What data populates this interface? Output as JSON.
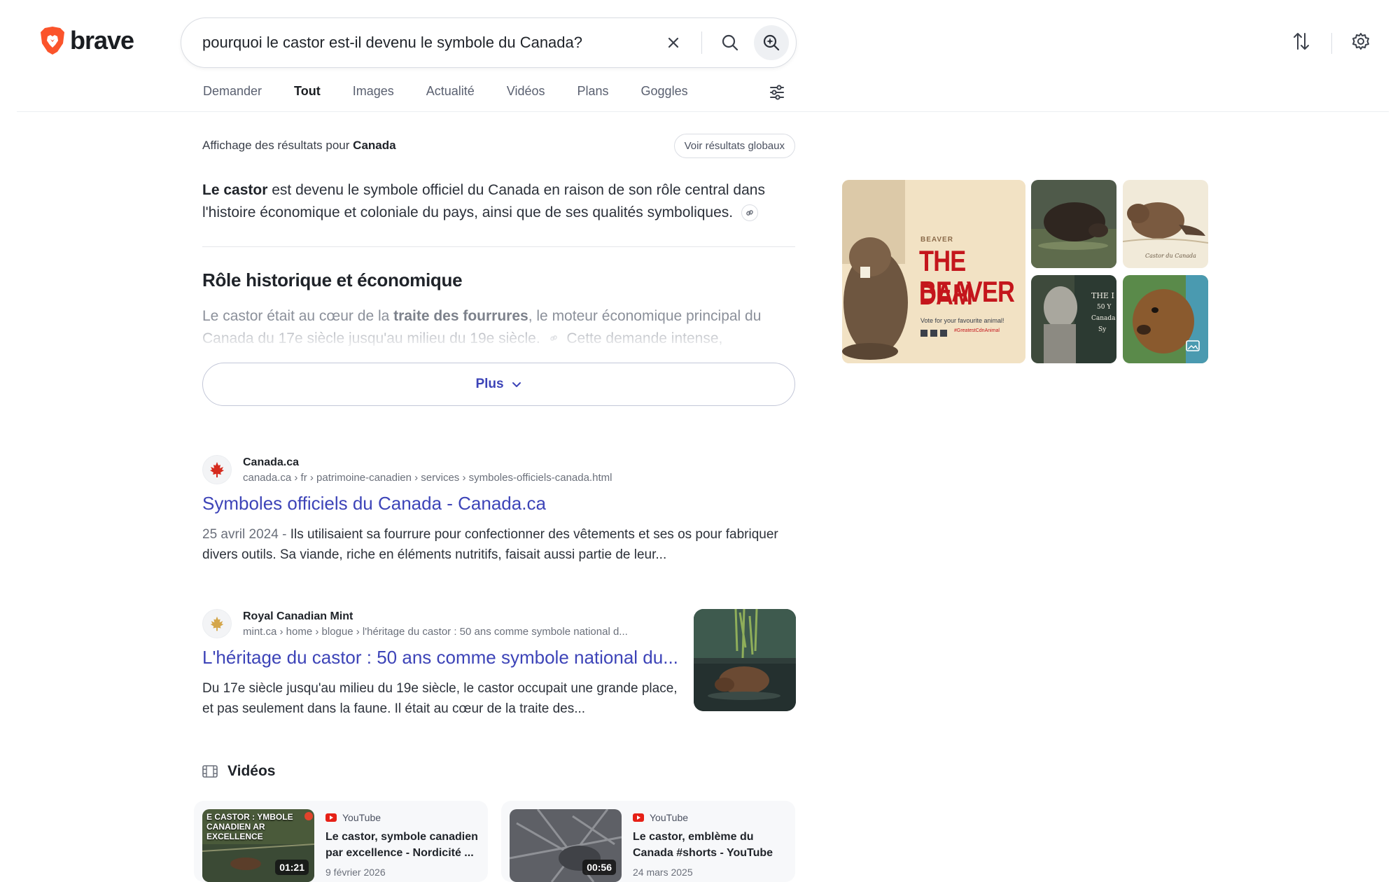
{
  "header": {
    "logo_text": "brave",
    "search_value": "pourquoi le castor est-il devenu le symbole du Canada?",
    "brand_color": "#fb542b",
    "accent_color": "#3d44b8"
  },
  "tabs": [
    {
      "label": "Demander"
    },
    {
      "label": "Tout"
    },
    {
      "label": "Images"
    },
    {
      "label": "Actualité"
    },
    {
      "label": "Vidéos"
    },
    {
      "label": "Plans"
    },
    {
      "label": "Goggles"
    }
  ],
  "active_tab": "Tout",
  "showing": {
    "prefix": "Affichage des résultats pour",
    "region": "Canada",
    "global_button": "Voir résultats globaux"
  },
  "answer": {
    "bold": "Le castor",
    "text": "est devenu le symbole officiel du Canada en raison de son rôle central dans l'histoire économique et coloniale du pays, ainsi que de ses qualités symboliques.",
    "section_title": "Rôle historique et économique",
    "fade_prefix": "Le castor était au cœur de la",
    "fade_bold": "traite des fourrures",
    "fade_suffix": ", le moteur économique principal du Canada du 17e siècle jusqu'au milieu du 19e siècle.",
    "fade_tail": "Cette demande intense,",
    "more_button": "Plus"
  },
  "results": [
    {
      "site": "Canada.ca",
      "url": "canada.ca › fr › patrimoine-canadien › services › symboles-officiels-canada.html",
      "title": "Symboles officiels du Canada - Canada.ca",
      "date": "25 avril 2024 -",
      "snippet": "Ils utilisaient sa fourrure pour confectionner des vêtements et ses os pour fabriquer divers outils. Sa viande, riche en éléments nutritifs, faisait aussi partie de leur..."
    },
    {
      "site": "Royal Canadian Mint",
      "url": "mint.ca › home › blogue › l'héritage du castor : 50 ans comme symbole national d...",
      "title": "L'héritage du castor : 50 ans comme symbole national du...",
      "snippet": "Du 17e siècle jusqu'au milieu du 19e siècle, le castor occupait une grande place, et pas seulement dans la faune. Il était au cœur de la traite des..."
    }
  ],
  "videos": {
    "title": "Vidéos",
    "items": [
      {
        "source": "YouTube",
        "title": "Le castor, symbole canadien par excellence - Nordicité ...",
        "date": "9 février 2026",
        "duration": "01:21",
        "thumb_text": "E CASTOR : YMBOLE CANADIEN AR EXCELLENCE"
      },
      {
        "source": "YouTube",
        "title": "Le castor, emblème du Canada #shorts - YouTube",
        "date": "24 mars 2025",
        "duration": "00:56"
      }
    ]
  },
  "images": {
    "poster_small": "BEAVER",
    "poster_title_1": "THE DAM",
    "poster_title_2": "BEAVER",
    "poster_caption": "Vote for your favourite animal!",
    "poster_tag": "#GreatestCdnAnimal",
    "caption_3": "Castor du Canada",
    "text_5_line1": "THE I",
    "text_5_line2": "50 Y",
    "text_5_line3": "Canada",
    "text_5_line4": "Sy"
  }
}
